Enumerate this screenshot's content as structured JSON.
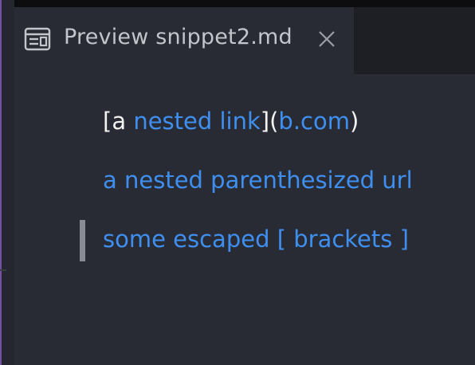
{
  "tab": {
    "label": "Preview snippet2.md",
    "icon": "preview-icon",
    "close_icon": "close-icon"
  },
  "preview": {
    "line1": {
      "open_bracket": "[a ",
      "link_text": "nested link",
      "middle": "](",
      "link_url": "b.com",
      "close_paren": ")"
    },
    "line2": {
      "link_text": "a nested parenthesized url"
    },
    "line3": {
      "link_text": "some escaped [ brackets ]"
    }
  },
  "colors": {
    "link": "#3f8ff0",
    "text": "#f2f2f2",
    "editor_bg": "#292b34",
    "quote_bar": "#8a8c93",
    "accent_edge": "#7a4fa0"
  }
}
